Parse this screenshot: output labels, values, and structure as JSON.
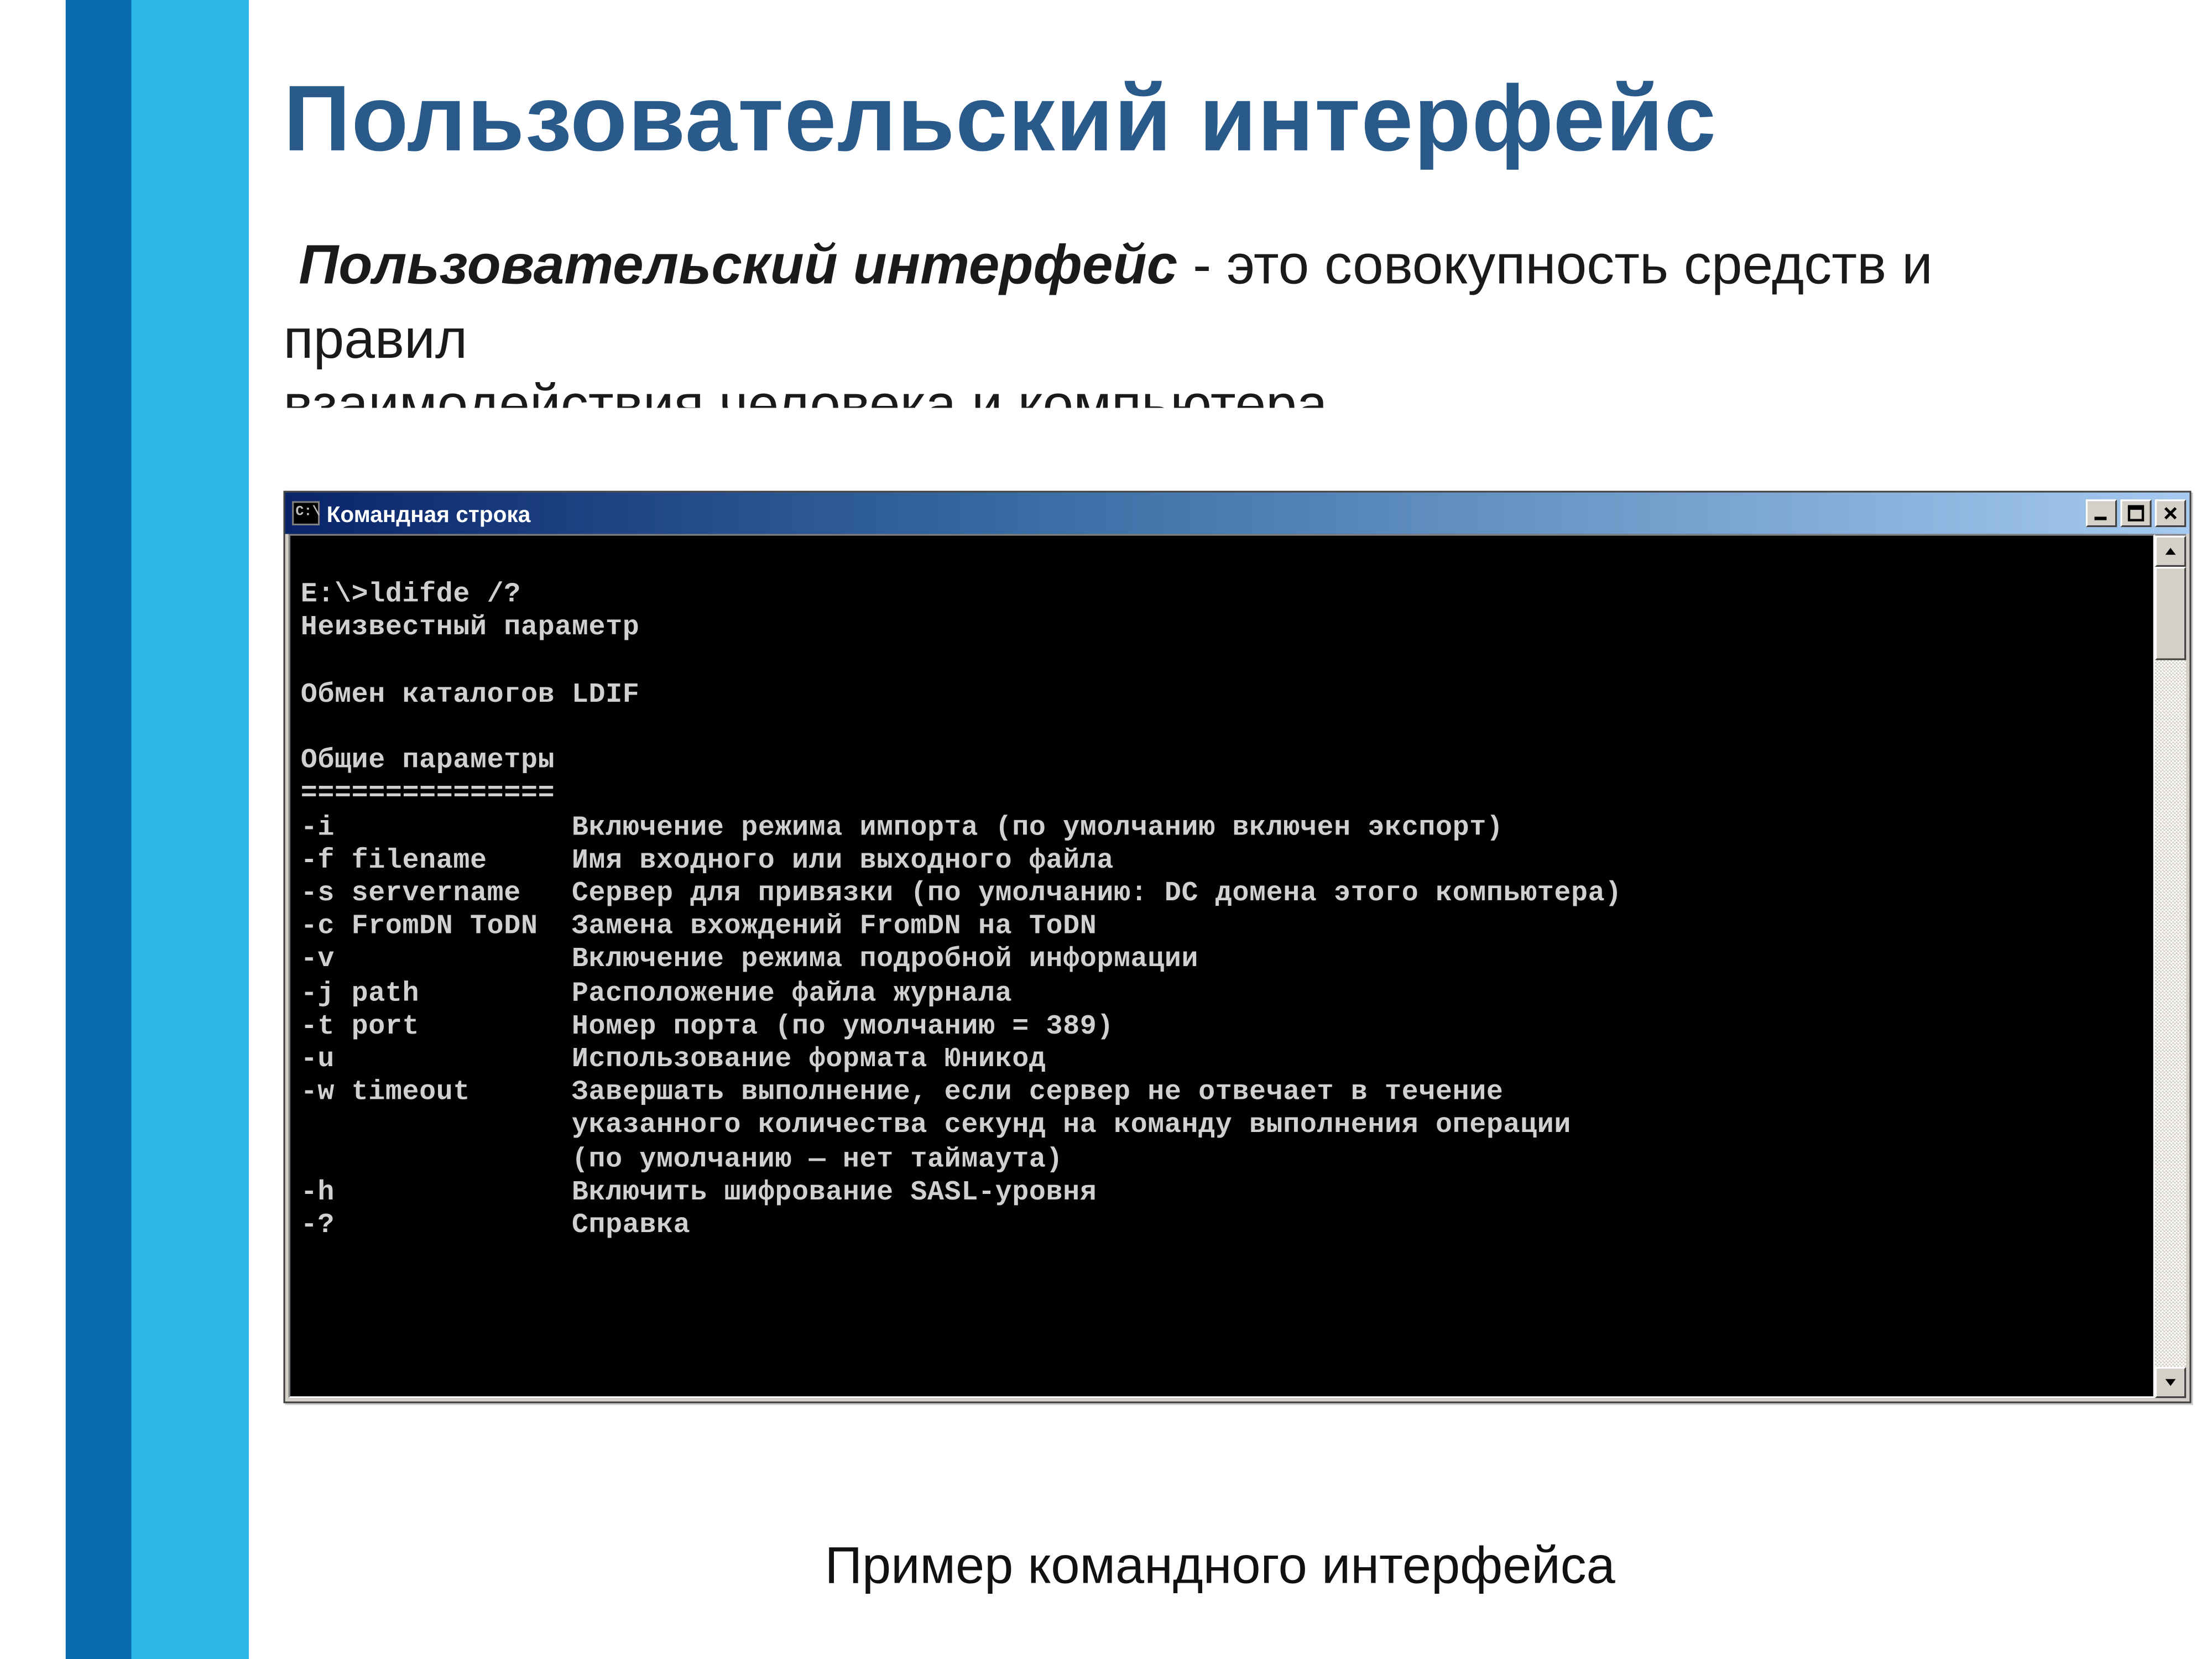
{
  "slide": {
    "title": "Пользовательский интерфейс",
    "definition_term": "Пользовательский интерфейс",
    "definition_rest": " - это совокупность средств и правил",
    "definition_cutoff": "взаимодействия человека и компьютера",
    "caption": "Пример командного интерфейса"
  },
  "cmd": {
    "title": "Командная строка",
    "icon_text": "C:\\",
    "lines": [
      "",
      "E:\\>ldifde /?",
      "Неизвестный параметр",
      "",
      "Обмен каталогов LDIF",
      "",
      "Общие параметры",
      "===============",
      "-i              Включение режима импорта (по умолчанию включен экспорт)",
      "-f filename     Имя входного или выходного файла",
      "-s servername   Сервер для привязки (по умолчанию: DC домена этого компьютера)",
      "-c FromDN ToDN  Замена вхождений FromDN на ToDN",
      "-v              Включение режима подробной информации",
      "-j path         Расположение файла журнала",
      "-t port         Номер порта (по умолчанию = 389)",
      "-u              Использование формата Юникод",
      "-w timeout      Завершать выполнение, если сервер не отвечает в течение",
      "                указанного количества секунд на команду выполнения операции",
      "                (по умолчанию — нет таймаута)",
      "-h              Включить шифрование SASL-уровня",
      "-?              Справка",
      ""
    ]
  }
}
